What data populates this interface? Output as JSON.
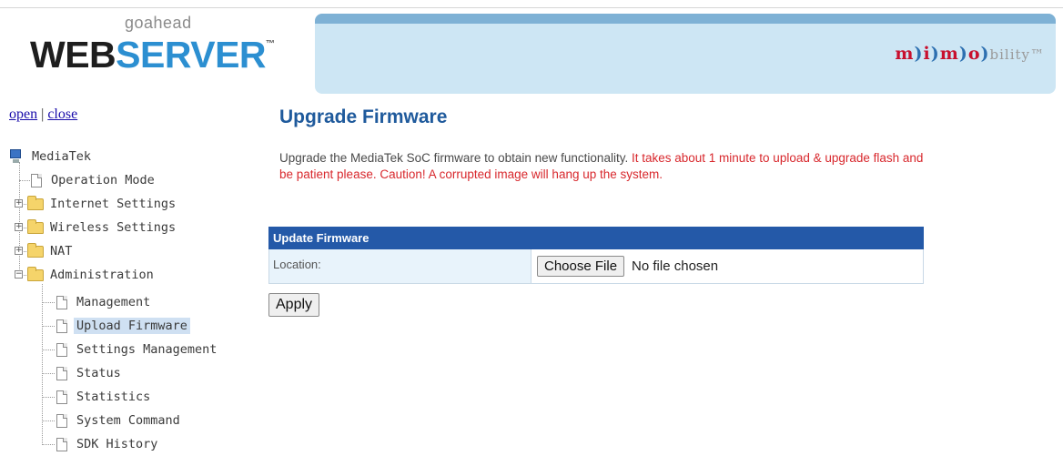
{
  "header": {
    "logo_small": "goahead",
    "logo_web": "WEB",
    "logo_server": "SERVER",
    "logo_tm": "™",
    "brand": {
      "p1": "m",
      "p2": ")",
      "p3": "i",
      "p4": ")",
      "p5": "m",
      "p6": ")",
      "p7": "o",
      "p8": ")",
      "p9": "bility",
      "p10": "™"
    }
  },
  "nav": {
    "open": "open",
    "separator": "|",
    "close": "close",
    "root": "MediaTek",
    "items": [
      {
        "label": "Operation Mode",
        "type": "page"
      },
      {
        "label": "Internet Settings",
        "type": "folder"
      },
      {
        "label": "Wireless Settings",
        "type": "folder"
      },
      {
        "label": "NAT",
        "type": "folder"
      },
      {
        "label": "Administration",
        "type": "folder-open"
      }
    ],
    "admin_children": [
      {
        "label": "Management"
      },
      {
        "label": "Upload Firmware",
        "selected": true
      },
      {
        "label": "Settings Management"
      },
      {
        "label": "Status"
      },
      {
        "label": "Statistics"
      },
      {
        "label": "System Command"
      },
      {
        "label": "SDK History"
      }
    ]
  },
  "main": {
    "title": "Upgrade Firmware",
    "desc": "Upgrade the MediaTek SoC firmware to obtain new functionality.",
    "warning": "It takes about 1 minute to upload & upgrade flash and be patient please. Caution! A corrupted image will hang up the system.",
    "table_header": "Update Firmware",
    "location_label": "Location:",
    "choose_file": "Choose File",
    "no_file": "No file chosen",
    "apply": "Apply"
  },
  "colors": {
    "accent": "#2459a8",
    "title": "#1f5a9c",
    "warning": "#d8282d",
    "banner": "#cde6f4"
  }
}
